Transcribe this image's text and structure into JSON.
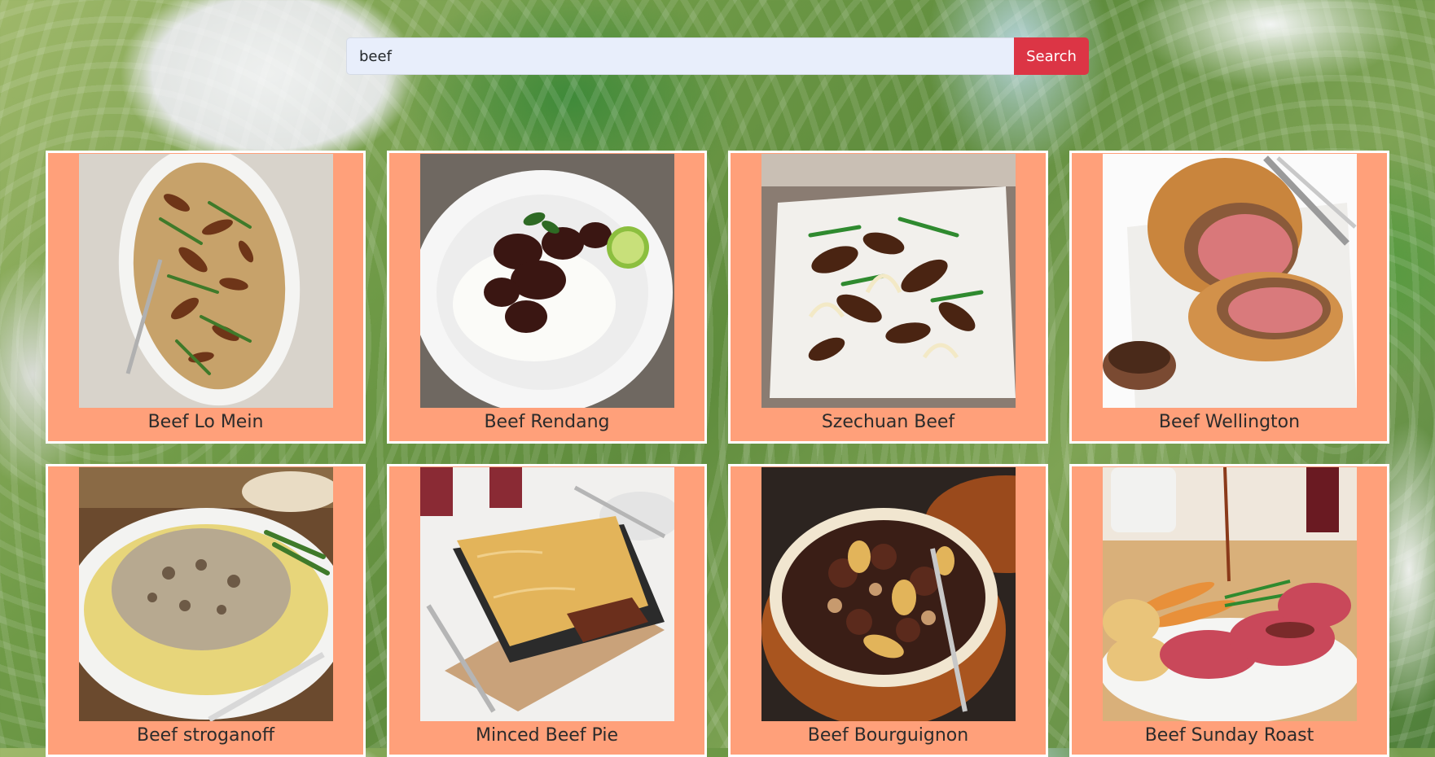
{
  "search": {
    "query": "beef",
    "button_label": "Search"
  },
  "colors": {
    "card_background": "#ffa07a",
    "card_border": "#ffffff",
    "search_button": "#dc3545",
    "search_input_background": "#e8eefb"
  },
  "recipes": [
    {
      "title": "Beef Lo Mein"
    },
    {
      "title": "Beef Rendang"
    },
    {
      "title": "Szechuan Beef"
    },
    {
      "title": "Beef Wellington"
    },
    {
      "title": "Beef stroganoff"
    },
    {
      "title": "Minced Beef Pie"
    },
    {
      "title": "Beef Bourguignon"
    },
    {
      "title": "Beef Sunday Roast"
    }
  ]
}
